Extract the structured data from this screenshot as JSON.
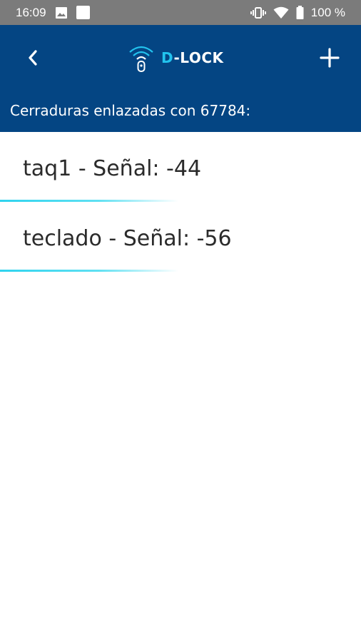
{
  "status_bar": {
    "time": "16:09",
    "battery": "100 %",
    "icons": [
      "image-icon",
      "app-square-icon",
      "vibrate-icon",
      "wifi-icon",
      "battery-icon"
    ]
  },
  "app_bar": {
    "back_icon": "chevron-left-icon",
    "add_icon": "plus-icon",
    "logo_prefix": "D",
    "logo_suffix": "-LOCK",
    "subtitle": "Cerraduras enlazadas con 67784:",
    "colors": {
      "background": "#044583",
      "accent": "#22c3ee"
    }
  },
  "locks": [
    {
      "label": "taq1 - Señal: -44"
    },
    {
      "label": "teclado - Señal: -56"
    }
  ]
}
